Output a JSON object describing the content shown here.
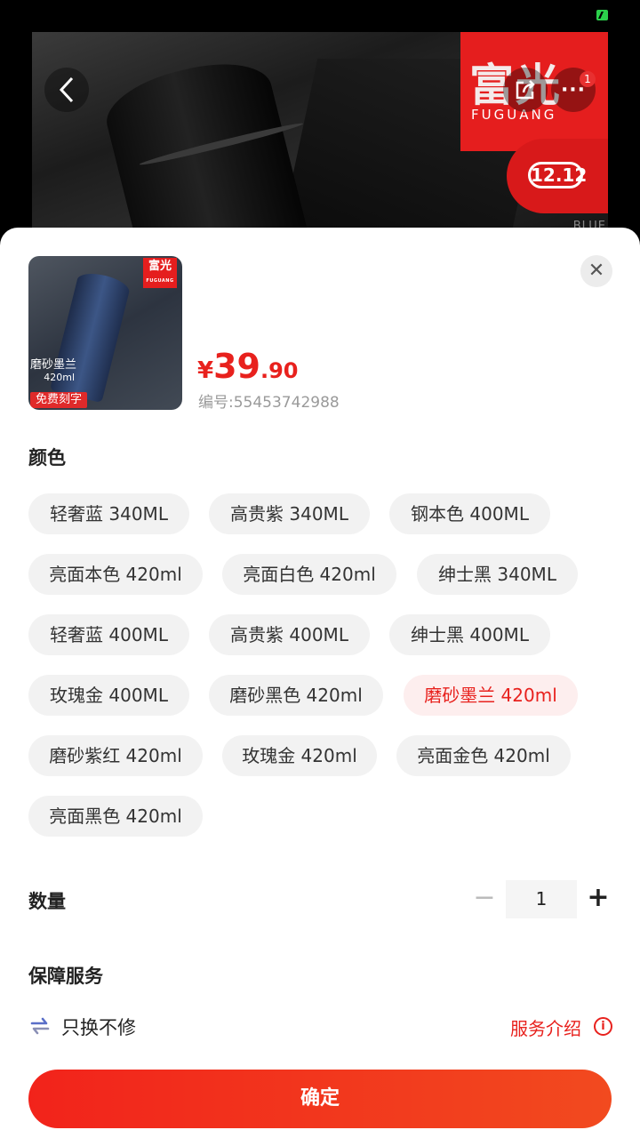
{
  "hero": {
    "brand_cn": "富光",
    "brand_en": "FUGUANG",
    "promo": "12.12",
    "box_text": "BLUE"
  },
  "nav": {
    "more_badge": "1"
  },
  "product": {
    "thumb_brand_cn": "富光",
    "thumb_brand_en": "FUGUANG",
    "thumb_color_label": "磨砂墨兰",
    "thumb_volume": "420ml",
    "thumb_free_engrave": "免费刻字",
    "price_currency": "¥",
    "price_integer": "39",
    "price_decimal": ".90",
    "sku": "编号:55453742988"
  },
  "color": {
    "title": "颜色",
    "options": [
      "轻奢蓝 340ML",
      "高贵紫 340ML",
      "钢本色 400ML",
      "亮面本色 420ml",
      "亮面白色 420ml",
      "绅士黑 340ML",
      "轻奢蓝 400ML",
      "高贵紫 400ML",
      "绅士黑 400ML",
      "玫瑰金 400ML",
      "磨砂黑色 420ml",
      "磨砂墨兰 420ml",
      "磨砂紫红 420ml",
      "玫瑰金 420ml",
      "亮面金色 420ml",
      "亮面黑色 420ml"
    ],
    "selected": "磨砂墨兰 420ml"
  },
  "quantity": {
    "title": "数量",
    "minus": "−",
    "value": "1",
    "plus": "+"
  },
  "guarantee": {
    "title": "保障服务",
    "service": "只换不修",
    "link": "服务介绍",
    "info_glyph": "i"
  },
  "confirm": "确定",
  "colors": {
    "accent": "#e8211d",
    "chip_bg": "#f2f2f2",
    "chip_selected_bg": "#fdeeee"
  }
}
